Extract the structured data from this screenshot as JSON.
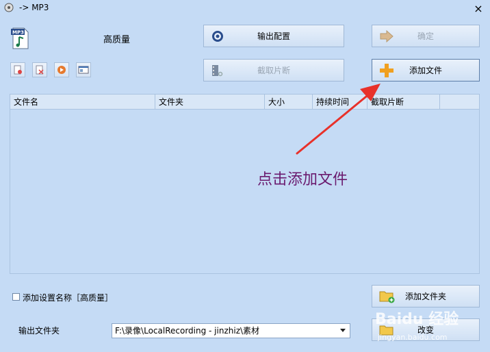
{
  "window": {
    "title": "-> MP3",
    "close_symbol": "×"
  },
  "format": {
    "icon_label": "MP3",
    "quality": "高质量"
  },
  "buttons": {
    "output_config": "输出配置",
    "confirm": "确定",
    "cut_clip": "截取片断",
    "add_file": "添加文件",
    "add_folder": "添加文件夹",
    "change": "改变"
  },
  "table": {
    "columns": [
      "文件名",
      "文件夹",
      "大小",
      "持续时间",
      "截取片断"
    ]
  },
  "annotation": "点击添加文件",
  "options": {
    "add_setting_name_label": "添加设置名称［高质量］"
  },
  "output": {
    "label": "输出文件夹",
    "path": "F:\\录像\\LocalRecording - jinzhiz\\素材"
  },
  "watermark": {
    "brand": "Baidu 经验",
    "url": "jingyan.baidu.com"
  },
  "colors": {
    "background": "#c5dbf5",
    "arrow": "#e8312a",
    "annotation": "#6a1a6e",
    "add_icon": "#f0a020"
  }
}
